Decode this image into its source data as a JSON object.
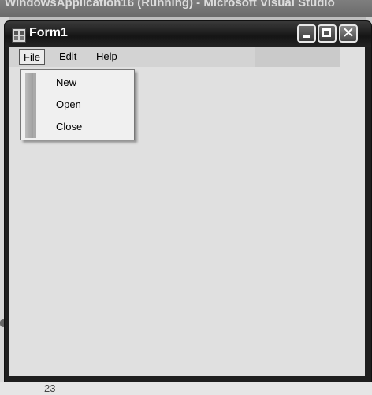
{
  "background_window": {
    "title": "WindowsApplication16 (Running) - Microsoft Visual Studio",
    "bottom_text": "23"
  },
  "form": {
    "title": "Form1",
    "icon": "form-icon",
    "buttons": {
      "minimize": "minimize-icon",
      "maximize": "maximize-icon",
      "close": "close-icon",
      "close_glyph": "✕"
    }
  },
  "menubar": {
    "items": [
      {
        "label": "File"
      },
      {
        "label": "Edit"
      },
      {
        "label": "Help"
      }
    ]
  },
  "file_menu": {
    "items": [
      {
        "label": "New"
      },
      {
        "label": "Open"
      },
      {
        "label": "Close"
      }
    ]
  },
  "colors": {
    "titlebar": "#1f1f1f",
    "client": "#e0e0e0",
    "menubar": "#d3d3d3",
    "dropdown": "#f0f0f0"
  }
}
